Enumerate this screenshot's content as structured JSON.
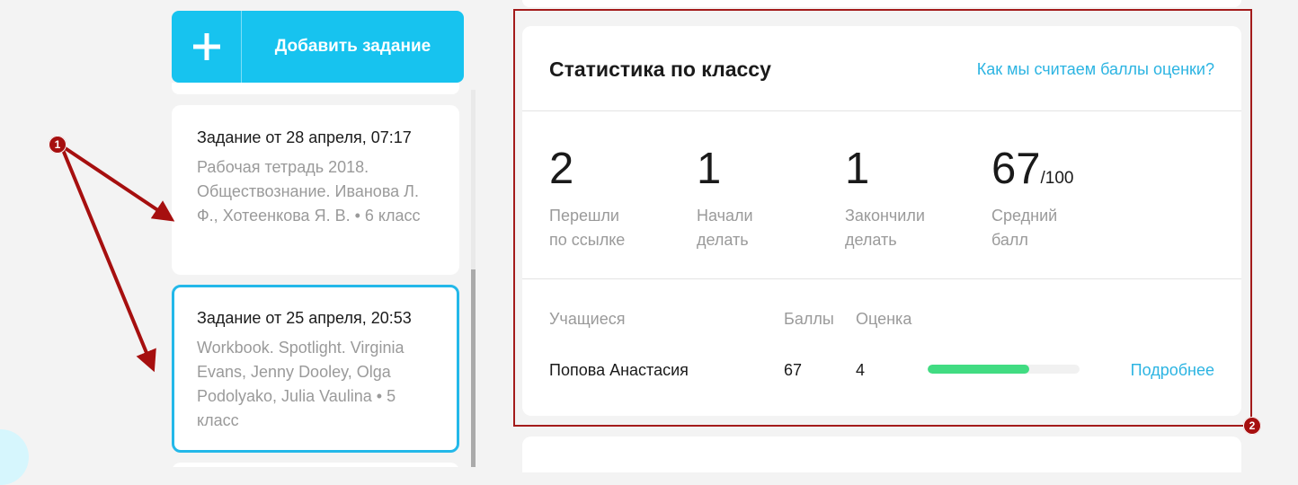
{
  "toolbar": {
    "add_task_label": "Добавить задание",
    "add_icon": "plus-icon"
  },
  "tasks": [
    {
      "title": "Задание от 28 апреля, 07:17",
      "description": "Рабочая тетрадь 2018. Обществознание. Иванова Л. Ф., Хотеенкова Я. В. • 6 класс",
      "selected": false
    },
    {
      "title": "Задание от 25 апреля, 20:53",
      "description": "Workbook. Spotlight. Virginia Evans, Jenny Dooley, Olga Podolyako, Julia Vaulina • 5 класс",
      "selected": true
    }
  ],
  "stats": {
    "title": "Статистика по классу",
    "help_link": "Как мы считаем баллы оценки?",
    "metrics": [
      {
        "value": "2",
        "label_line1": "Перешли",
        "label_line2": "по ссылке"
      },
      {
        "value": "1",
        "label_line1": "Начали",
        "label_line2": "делать"
      },
      {
        "value": "1",
        "label_line1": "Закончили",
        "label_line2": "делать"
      },
      {
        "value": "67",
        "suffix": "/100",
        "label_line1": "Средний",
        "label_line2": "балл"
      }
    ],
    "table": {
      "headers": {
        "student": "Учащиеся",
        "score": "Баллы",
        "grade": "Оценка"
      },
      "rows": [
        {
          "student": "Попова Анастасия",
          "score": "67",
          "grade": "4",
          "progress": 0.67,
          "details_link": "Подробнее"
        }
      ]
    }
  },
  "annotations": {
    "marker_1": "1",
    "marker_2": "2",
    "color": "#a60f0f"
  },
  "colors": {
    "accent": "#17c3ef",
    "link": "#2cb4e2",
    "progress": "#41dc82"
  }
}
